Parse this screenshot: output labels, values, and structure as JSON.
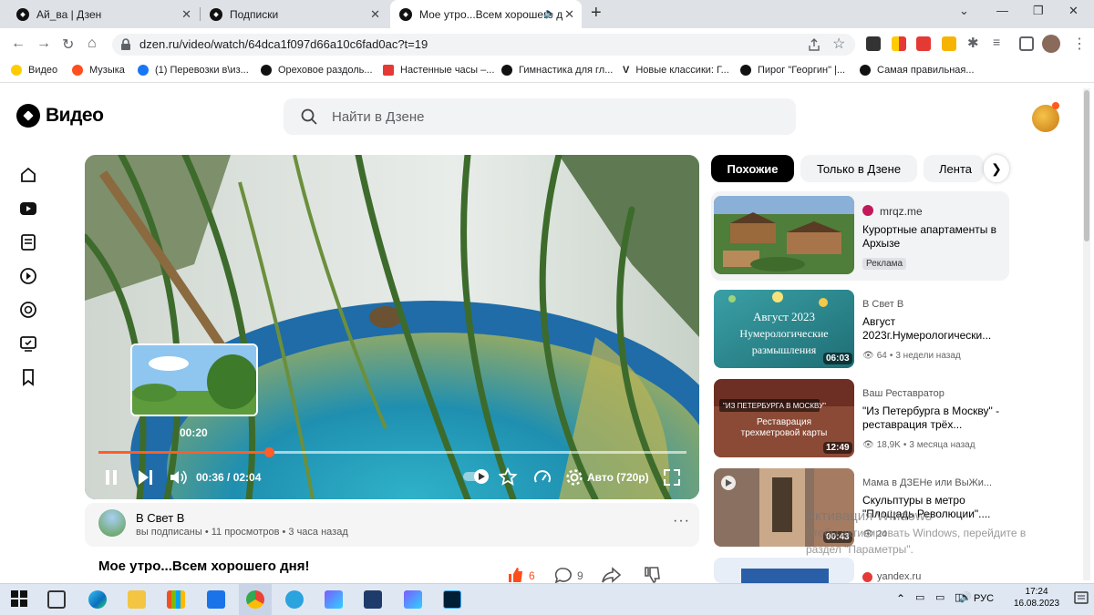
{
  "browser": {
    "tabs": [
      {
        "title": "Ай_ва | Дзен"
      },
      {
        "title": "Подписки"
      },
      {
        "title": "Мое утро...Всем хорошего д"
      }
    ],
    "url": "dzen.ru/video/watch/64dca1f097d66a10c6fad0ac?t=19",
    "bookmarks": [
      {
        "label": "Видео",
        "color": "#111111"
      },
      {
        "label": "Музыка",
        "color": "#ff4f1f"
      },
      {
        "label": "(1) Перевозки в\\из...",
        "color": "#1877f2"
      },
      {
        "label": "Ореховое раздоль...",
        "color": "#111111"
      },
      {
        "label": "Настенные часы –...",
        "color": "#e53935"
      },
      {
        "label": "Гимнастика для гл...",
        "color": "#111111"
      },
      {
        "label": "Новые классики: Г...",
        "color": "#111111"
      },
      {
        "label": "Пирог \"Георгин\" |...",
        "color": "#111111"
      },
      {
        "label": "Самая правильная...",
        "color": "#111111"
      }
    ]
  },
  "header": {
    "logo_text": "Видео",
    "search_placeholder": "Найти в Дзене"
  },
  "player": {
    "preview_time": "00:20",
    "current_time": "00:36",
    "duration": "02:04",
    "timecode": "00:36 / 02:04",
    "progress": 0.29,
    "quality": "Авто (720p)"
  },
  "channel": {
    "name": "В Свет В",
    "meta": "вы подписаны • 11 просмотров • 3 часа назад",
    "more": "···"
  },
  "video": {
    "title": "Мое утро...Всем хорошего дня!",
    "likes": "6",
    "comments": "9"
  },
  "filters": [
    {
      "label": "Похожие",
      "active": true
    },
    {
      "label": "Только в Дзене",
      "active": false
    },
    {
      "label": "Лента",
      "active": false
    }
  ],
  "ad": {
    "source": "mrqz.me",
    "title": "Курортные апартаменты в Архызе",
    "badge": "Реклама"
  },
  "related": [
    {
      "channel": "В Свет В",
      "title": "Август 2023г.Нумерологически...",
      "views": "64",
      "age": "3 недели назад",
      "duration": "06:03",
      "thumb_text": "Август 2023 Нумерологические размышления"
    },
    {
      "channel": "Ваш Реставратор",
      "title": "\"Из Петербурга в Москву\" - реставрация трёх...",
      "views": "18,9K",
      "age": "3 месяца назад",
      "duration": "12:49",
      "thumb_text_1": "\"ИЗ ПЕТЕРБУРГА В МОСКВУ\"",
      "thumb_text_2": "Реставрация трехметровой карты"
    },
    {
      "channel": "Мама в ДЗЕНе или ВыЖи...",
      "title": "Скульптуры в метро \"Площадь Революции\"....",
      "views": "24",
      "age": "",
      "duration": "00:43"
    },
    {
      "channel": "yandex.ru",
      "title": ""
    }
  ],
  "activation": {
    "line1": "Активация Windows",
    "line2": "Чтобы активировать Windows, перейдите в",
    "line3": "раздел \"Параметры\"."
  },
  "taskbar": {
    "lang": "РУС",
    "time": "17:24",
    "date": "16.08.2023"
  }
}
